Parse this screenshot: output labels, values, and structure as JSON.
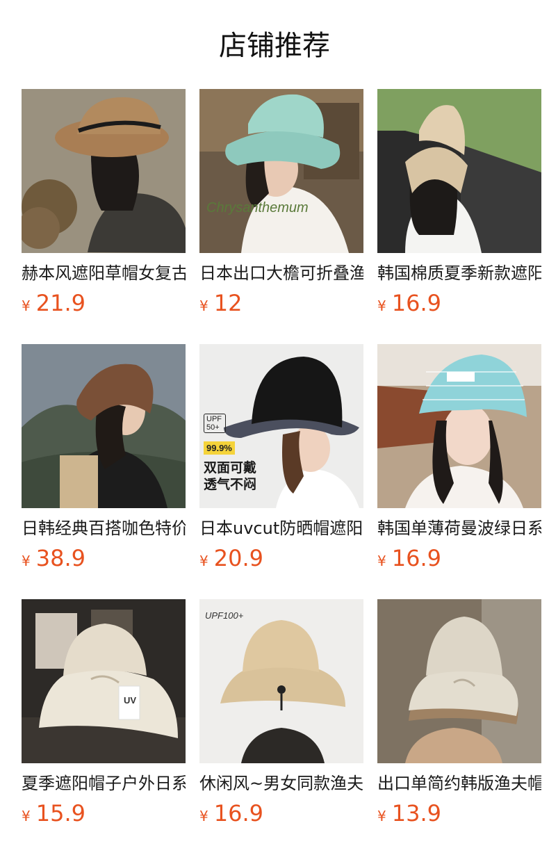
{
  "page": {
    "title": "店铺推荐"
  },
  "products": [
    {
      "name": "赫本风遮阳草帽女复古",
      "currency": "¥",
      "price": "21.9",
      "image_icon": "straw-hat-photo"
    },
    {
      "name": "日本出口大檐可折叠渔夫帽",
      "currency": "¥",
      "price": "12",
      "image_icon": "teal-bucket-hat-photo",
      "image_text": "Chrysanthemum"
    },
    {
      "name": "韩国棉质夏季新款遮阳帽",
      "currency": "¥",
      "price": "16.9",
      "image_icon": "beige-hat-car-photo"
    },
    {
      "name": "日韩经典百搭咖色特价",
      "currency": "¥",
      "price": "38.9",
      "image_icon": "brown-knit-hat-photo"
    },
    {
      "name": "日本uvcut防晒帽遮阳帽",
      "currency": "¥",
      "price": "20.9",
      "image_icon": "black-bucket-hat-photo",
      "image_badge": "UPF 50+",
      "image_rate": "99.9%",
      "image_caption": [
        "双面可戴",
        "透气不闷"
      ]
    },
    {
      "name": "韩国单薄荷曼波绿日系",
      "currency": "¥",
      "price": "16.9",
      "image_icon": "striped-blue-hat-photo"
    },
    {
      "name": "夏季遮阳帽子户外日系",
      "currency": "¥",
      "price": "15.9",
      "image_icon": "cream-hat-uv-tag-photo",
      "image_tag": "UV"
    },
    {
      "name": "休闲风~男女同款渔夫帽",
      "currency": "¥",
      "price": "16.9",
      "image_icon": "khaki-bucket-hat-photo",
      "image_badge": "UPF100+"
    },
    {
      "name": "出口单简约韩版渔夫帽",
      "currency": "¥",
      "price": "13.9",
      "image_icon": "beige-hat-hand-photo"
    }
  ]
}
